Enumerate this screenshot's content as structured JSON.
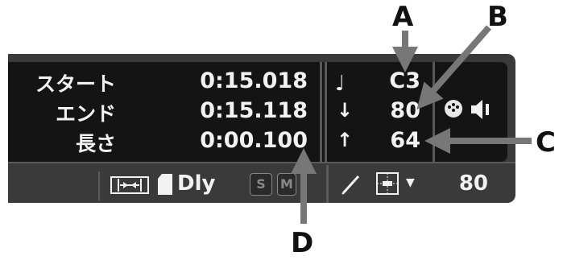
{
  "event_list": {
    "start_label": "スタート",
    "end_label": "エンド",
    "length_label": "長さ",
    "start_value": "0:15.018",
    "end_value": "0:15.118",
    "length_value": "0:00.100"
  },
  "note": {
    "pitch": "C3",
    "velocity_on": "80",
    "velocity_off": "64"
  },
  "toolbar": {
    "delay_label": "Dly",
    "solo_label": "S",
    "mute_label": "M",
    "input_value": "80"
  },
  "callouts": {
    "a": "A",
    "b": "B",
    "c": "C",
    "d": "D"
  },
  "icons": [
    "note-icon",
    "velocity-down-icon",
    "velocity-up-icon",
    "midi-port-icon",
    "speaker-icon",
    "pencil-icon",
    "quantize-icon",
    "chevron-down-icon",
    "delay-icon",
    "page-icon"
  ]
}
